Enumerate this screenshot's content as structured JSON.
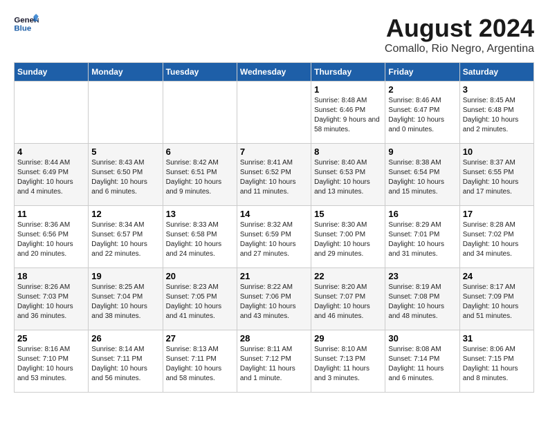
{
  "logo": {
    "line1": "General",
    "line2": "Blue"
  },
  "header": {
    "month": "August 2024",
    "location": "Comallo, Rio Negro, Argentina"
  },
  "weekdays": [
    "Sunday",
    "Monday",
    "Tuesday",
    "Wednesday",
    "Thursday",
    "Friday",
    "Saturday"
  ],
  "weeks": [
    [
      {
        "day": "",
        "info": ""
      },
      {
        "day": "",
        "info": ""
      },
      {
        "day": "",
        "info": ""
      },
      {
        "day": "",
        "info": ""
      },
      {
        "day": "1",
        "info": "Sunrise: 8:48 AM\nSunset: 6:46 PM\nDaylight: 9 hours\nand 58 minutes."
      },
      {
        "day": "2",
        "info": "Sunrise: 8:46 AM\nSunset: 6:47 PM\nDaylight: 10 hours\nand 0 minutes."
      },
      {
        "day": "3",
        "info": "Sunrise: 8:45 AM\nSunset: 6:48 PM\nDaylight: 10 hours\nand 2 minutes."
      }
    ],
    [
      {
        "day": "4",
        "info": "Sunrise: 8:44 AM\nSunset: 6:49 PM\nDaylight: 10 hours\nand 4 minutes."
      },
      {
        "day": "5",
        "info": "Sunrise: 8:43 AM\nSunset: 6:50 PM\nDaylight: 10 hours\nand 6 minutes."
      },
      {
        "day": "6",
        "info": "Sunrise: 8:42 AM\nSunset: 6:51 PM\nDaylight: 10 hours\nand 9 minutes."
      },
      {
        "day": "7",
        "info": "Sunrise: 8:41 AM\nSunset: 6:52 PM\nDaylight: 10 hours\nand 11 minutes."
      },
      {
        "day": "8",
        "info": "Sunrise: 8:40 AM\nSunset: 6:53 PM\nDaylight: 10 hours\nand 13 minutes."
      },
      {
        "day": "9",
        "info": "Sunrise: 8:38 AM\nSunset: 6:54 PM\nDaylight: 10 hours\nand 15 minutes."
      },
      {
        "day": "10",
        "info": "Sunrise: 8:37 AM\nSunset: 6:55 PM\nDaylight: 10 hours\nand 17 minutes."
      }
    ],
    [
      {
        "day": "11",
        "info": "Sunrise: 8:36 AM\nSunset: 6:56 PM\nDaylight: 10 hours\nand 20 minutes."
      },
      {
        "day": "12",
        "info": "Sunrise: 8:34 AM\nSunset: 6:57 PM\nDaylight: 10 hours\nand 22 minutes."
      },
      {
        "day": "13",
        "info": "Sunrise: 8:33 AM\nSunset: 6:58 PM\nDaylight: 10 hours\nand 24 minutes."
      },
      {
        "day": "14",
        "info": "Sunrise: 8:32 AM\nSunset: 6:59 PM\nDaylight: 10 hours\nand 27 minutes."
      },
      {
        "day": "15",
        "info": "Sunrise: 8:30 AM\nSunset: 7:00 PM\nDaylight: 10 hours\nand 29 minutes."
      },
      {
        "day": "16",
        "info": "Sunrise: 8:29 AM\nSunset: 7:01 PM\nDaylight: 10 hours\nand 31 minutes."
      },
      {
        "day": "17",
        "info": "Sunrise: 8:28 AM\nSunset: 7:02 PM\nDaylight: 10 hours\nand 34 minutes."
      }
    ],
    [
      {
        "day": "18",
        "info": "Sunrise: 8:26 AM\nSunset: 7:03 PM\nDaylight: 10 hours\nand 36 minutes."
      },
      {
        "day": "19",
        "info": "Sunrise: 8:25 AM\nSunset: 7:04 PM\nDaylight: 10 hours\nand 38 minutes."
      },
      {
        "day": "20",
        "info": "Sunrise: 8:23 AM\nSunset: 7:05 PM\nDaylight: 10 hours\nand 41 minutes."
      },
      {
        "day": "21",
        "info": "Sunrise: 8:22 AM\nSunset: 7:06 PM\nDaylight: 10 hours\nand 43 minutes."
      },
      {
        "day": "22",
        "info": "Sunrise: 8:20 AM\nSunset: 7:07 PM\nDaylight: 10 hours\nand 46 minutes."
      },
      {
        "day": "23",
        "info": "Sunrise: 8:19 AM\nSunset: 7:08 PM\nDaylight: 10 hours\nand 48 minutes."
      },
      {
        "day": "24",
        "info": "Sunrise: 8:17 AM\nSunset: 7:09 PM\nDaylight: 10 hours\nand 51 minutes."
      }
    ],
    [
      {
        "day": "25",
        "info": "Sunrise: 8:16 AM\nSunset: 7:10 PM\nDaylight: 10 hours\nand 53 minutes."
      },
      {
        "day": "26",
        "info": "Sunrise: 8:14 AM\nSunset: 7:11 PM\nDaylight: 10 hours\nand 56 minutes."
      },
      {
        "day": "27",
        "info": "Sunrise: 8:13 AM\nSunset: 7:11 PM\nDaylight: 10 hours\nand 58 minutes."
      },
      {
        "day": "28",
        "info": "Sunrise: 8:11 AM\nSunset: 7:12 PM\nDaylight: 11 hours\nand 1 minute."
      },
      {
        "day": "29",
        "info": "Sunrise: 8:10 AM\nSunset: 7:13 PM\nDaylight: 11 hours\nand 3 minutes."
      },
      {
        "day": "30",
        "info": "Sunrise: 8:08 AM\nSunset: 7:14 PM\nDaylight: 11 hours\nand 6 minutes."
      },
      {
        "day": "31",
        "info": "Sunrise: 8:06 AM\nSunset: 7:15 PM\nDaylight: 11 hours\nand 8 minutes."
      }
    ]
  ]
}
